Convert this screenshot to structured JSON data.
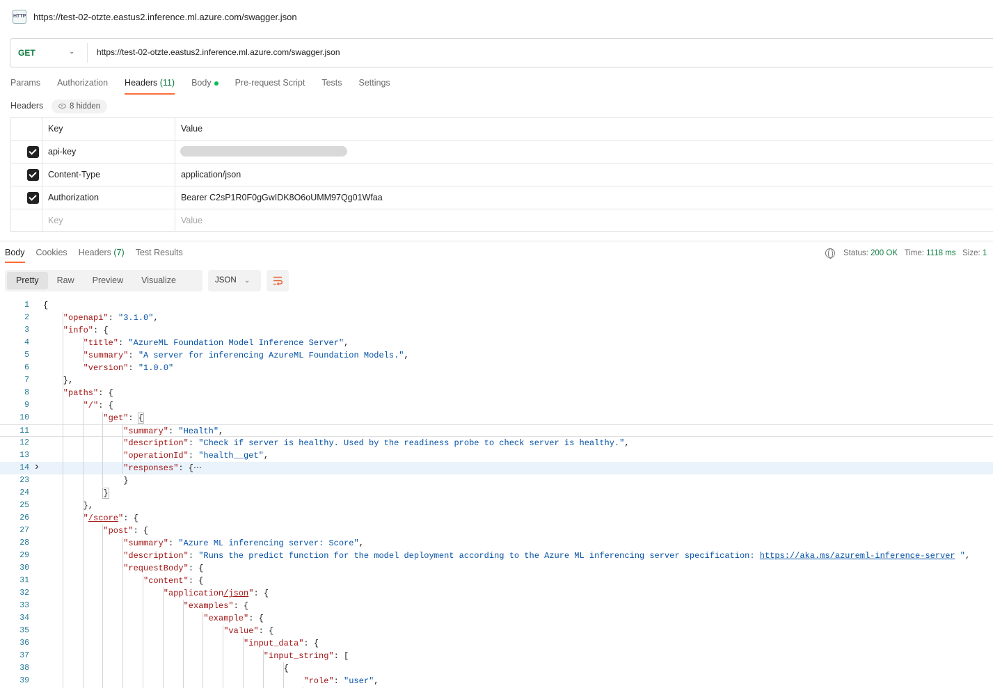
{
  "window": {
    "icon_label": "HTTP",
    "title": "https://test-02-otzte.eastus2.inference.ml.azure.com/swagger.json"
  },
  "request": {
    "method": "GET",
    "url": "https://test-02-otzte.eastus2.inference.ml.azure.com/swagger.json"
  },
  "request_tabs": [
    {
      "label": "Params",
      "count": ""
    },
    {
      "label": "Authorization",
      "count": ""
    },
    {
      "label": "Headers",
      "count": "(11)"
    },
    {
      "label": "Body",
      "count": ""
    },
    {
      "label": "Pre-request Script",
      "count": ""
    },
    {
      "label": "Tests",
      "count": ""
    },
    {
      "label": "Settings",
      "count": ""
    }
  ],
  "headers_section": {
    "label": "Headers",
    "hidden_label": "8 hidden",
    "col_key": "Key",
    "col_value": "Value",
    "rows": [
      {
        "key": "api-key",
        "value": "",
        "checked": true
      },
      {
        "key": "Content-Type",
        "value": "application/json",
        "checked": true
      },
      {
        "key": "Authorization",
        "value": "Bearer C2sP1R0F0gGwIDK8O6oUMM97Qg01Wfaa",
        "checked": true
      }
    ],
    "new_key_placeholder": "Key",
    "new_value_placeholder": "Value"
  },
  "response_tabs": [
    {
      "label": "Body",
      "count": ""
    },
    {
      "label": "Cookies",
      "count": ""
    },
    {
      "label": "Headers",
      "count": "(7)"
    },
    {
      "label": "Test Results",
      "count": ""
    }
  ],
  "status": {
    "status_label": "Status:",
    "status_value": "200 OK",
    "time_label": "Time:",
    "time_value": "1118 ms",
    "size_label": "Size:",
    "size_value": "1"
  },
  "view_modes": [
    "Pretty",
    "Raw",
    "Preview",
    "Visualize"
  ],
  "format": "JSON",
  "code_lines": [
    {
      "n": "1",
      "indent": 0,
      "text": "{"
    },
    {
      "n": "2",
      "indent": 1,
      "key": "openapi",
      "val": "3.1.0",
      "tail": ","
    },
    {
      "n": "3",
      "indent": 1,
      "key": "info",
      "tail": ": {"
    },
    {
      "n": "4",
      "indent": 2,
      "key": "title",
      "val": "AzureML Foundation Model Inference Server",
      "tail": ","
    },
    {
      "n": "5",
      "indent": 2,
      "key": "summary",
      "val": "A server for inferencing AzureML Foundation Models.",
      "tail": ","
    },
    {
      "n": "6",
      "indent": 2,
      "key": "version",
      "val": "1.0.0"
    },
    {
      "n": "7",
      "indent": 1,
      "text": "},"
    },
    {
      "n": "8",
      "indent": 1,
      "key": "paths",
      "tail": ": {"
    },
    {
      "n": "9",
      "indent": 2,
      "key": "/",
      "tail": ": {"
    },
    {
      "n": "10",
      "indent": 3,
      "key": "get",
      "tail": ": {"
    },
    {
      "n": "11",
      "indent": 4,
      "key": "summary",
      "val": "Health",
      "tail": ","
    },
    {
      "n": "12",
      "indent": 4,
      "key": "description",
      "val": "Check if server is healthy. Used by the readiness probe to check server is healthy.",
      "tail": ","
    },
    {
      "n": "13",
      "indent": 4,
      "key": "operationId",
      "val": "health__get",
      "tail": ","
    },
    {
      "n": "14",
      "indent": 4,
      "key": "responses",
      "tail": ": {⋯"
    },
    {
      "n": "23",
      "indent": 4,
      "text": "}"
    },
    {
      "n": "24",
      "indent": 3,
      "text": "}"
    },
    {
      "n": "25",
      "indent": 2,
      "text": "},"
    },
    {
      "n": "26",
      "indent": 2,
      "key": "/score",
      "tail": ": {"
    },
    {
      "n": "27",
      "indent": 3,
      "key": "post",
      "tail": ": {"
    },
    {
      "n": "28",
      "indent": 4,
      "key": "summary",
      "val": "Azure ML inferencing server: Score",
      "tail": ","
    },
    {
      "n": "29",
      "indent": 4,
      "key": "description",
      "val": "Runs the predict function for the model deployment according to the Azure ML inferencing server specification: ",
      "link": "https://aka.ms/azureml-inference-server",
      "after": " ",
      "tail": ","
    },
    {
      "n": "30",
      "indent": 4,
      "key": "requestBody",
      "tail": ": {"
    },
    {
      "n": "31",
      "indent": 5,
      "key": "content",
      "tail": ": {"
    },
    {
      "n": "32",
      "indent": 6,
      "key": "application/json",
      "tail": ": {"
    },
    {
      "n": "33",
      "indent": 7,
      "key": "examples",
      "tail": ": {"
    },
    {
      "n": "34",
      "indent": 8,
      "key": "example",
      "tail": ": {"
    },
    {
      "n": "35",
      "indent": 9,
      "key": "value",
      "tail": ": {"
    },
    {
      "n": "36",
      "indent": 10,
      "key": "input_data",
      "tail": ": {"
    },
    {
      "n": "37",
      "indent": 11,
      "key": "input_string",
      "tail": ": ["
    },
    {
      "n": "38",
      "indent": 12,
      "text": "{"
    },
    {
      "n": "39",
      "indent": 13,
      "key": "role",
      "val": "user",
      "tail": ","
    }
  ]
}
